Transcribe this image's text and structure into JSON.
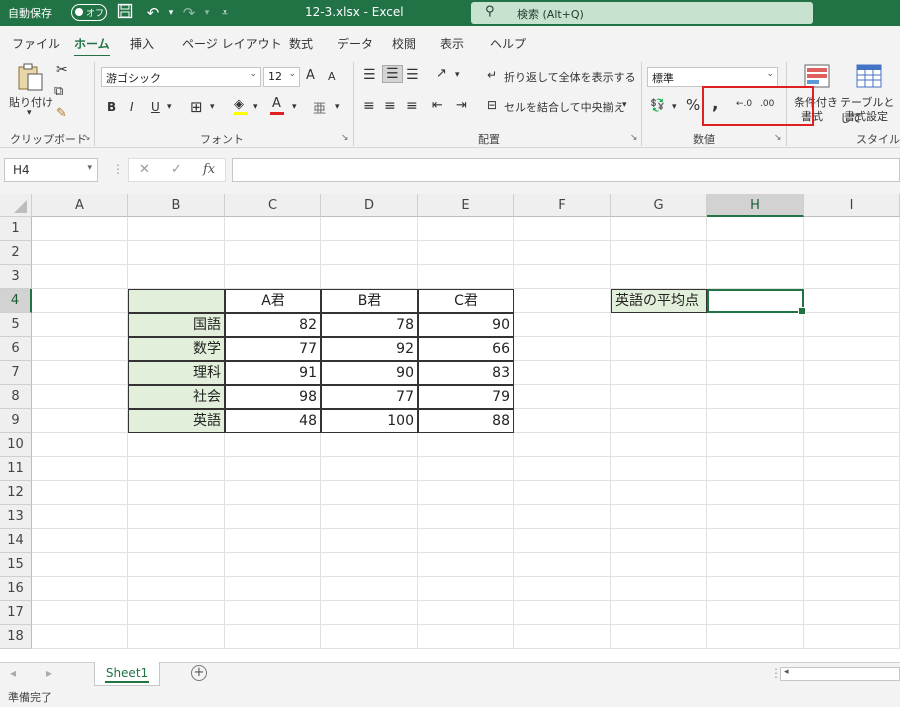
{
  "titlebar": {
    "autosave_label": "自動保存",
    "autosave_toggle": "オフ",
    "filename": "12-3.xlsx  -  Excel",
    "search_placeholder": "検索 (Alt+Q)"
  },
  "tabs": [
    "ファイル",
    "ホーム",
    "挿入",
    "ページ レイアウト",
    "数式",
    "データ",
    "校閲",
    "表示",
    "ヘルプ"
  ],
  "active_tab": "ホーム",
  "ribbon": {
    "paste_label": "貼り付け",
    "clipboard_group": "クリップボード",
    "font_name": "游ゴシック",
    "font_size": "12",
    "font_group": "フォント",
    "wrap_text": "折り返して全体を表示する",
    "merge_center": "セルを結合して中央揃え",
    "alignment_group": "配置",
    "number_format": "標準",
    "number_group": "数値",
    "cond_format_line1": "条件付き",
    "cond_format_line2": "書式",
    "table_format_line1": "テーブルとして",
    "table_format_line2": "書式設定",
    "styles_group": "スタイル",
    "bold": "B",
    "italic": "I",
    "underline": "U",
    "increase_font": "A",
    "decrease_font": "A"
  },
  "formula_bar": {
    "name_box": "H4",
    "fx": "fx",
    "formula": ""
  },
  "columns": [
    "A",
    "B",
    "C",
    "D",
    "E",
    "F",
    "G",
    "H",
    "I"
  ],
  "rows": [
    "1",
    "2",
    "3",
    "4",
    "5",
    "6",
    "7",
    "8",
    "9",
    "10",
    "11",
    "12",
    "13",
    "14",
    "15",
    "16",
    "17",
    "18"
  ],
  "selected_cell": "H4",
  "table": {
    "headers": [
      "",
      "A君",
      "B君",
      "C君"
    ],
    "rows": [
      {
        "subject": "国語",
        "values": [
          "82",
          "78",
          "90"
        ]
      },
      {
        "subject": "数学",
        "values": [
          "77",
          "92",
          "66"
        ]
      },
      {
        "subject": "理科",
        "values": [
          "91",
          "90",
          "83"
        ]
      },
      {
        "subject": "社会",
        "values": [
          "98",
          "77",
          "79"
        ]
      },
      {
        "subject": "英語",
        "values": [
          "48",
          "100",
          "88"
        ]
      }
    ]
  },
  "label_cell": "英語の平均点",
  "sheet_tab": "Sheet1",
  "status": "準備完了",
  "colors": {
    "accent": "#217346",
    "table_fill": "#e2efda",
    "highlight": "#e02020"
  }
}
